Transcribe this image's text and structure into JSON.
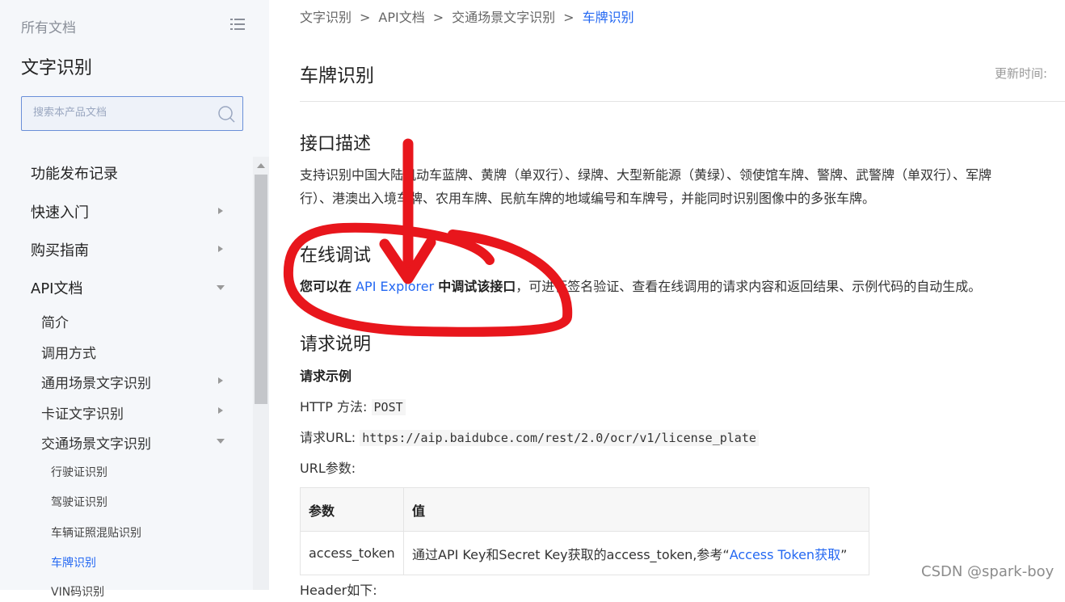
{
  "sidebar": {
    "all_docs": "所有文档",
    "product_title": "文字识别",
    "search_placeholder": "搜索本产品文档",
    "items": [
      {
        "label": "功能发布记录"
      },
      {
        "label": "快速入门"
      },
      {
        "label": "购买指南"
      },
      {
        "label": "API文档"
      }
    ],
    "api_children": [
      {
        "label": "简介"
      },
      {
        "label": "调用方式"
      },
      {
        "label": "通用场景文字识别"
      },
      {
        "label": "卡证文字识别"
      },
      {
        "label": "交通场景文字识别"
      }
    ],
    "traffic_children": [
      {
        "label": "行驶证识别"
      },
      {
        "label": "驾驶证识别"
      },
      {
        "label": "车辆证照混贴识别"
      },
      {
        "label": "车牌识别",
        "active": true
      },
      {
        "label": "VIN码识别"
      }
    ]
  },
  "breadcrumb": [
    "文字识别",
    "API文档",
    "交通场景文字识别",
    "车牌识别"
  ],
  "breadcrumb_sep": ">",
  "page": {
    "title": "车牌识别",
    "updated_label": "更新时间:",
    "section_interface": "接口描述",
    "interface_desc_line1": "支持识别中国大陆机动车蓝牌、黄牌（单双行）、绿牌、大型新能源（黄绿）、领使馆车牌、警牌、武警牌（单双行）、军牌",
    "interface_desc_line2": "行）、港澳出入境车牌、农用车牌、民航车牌的地域编号和车牌号，并能同时识别图像中的多张车牌。",
    "section_online": "在线调试",
    "online_prefix": "您可以在",
    "online_link": "API Explorer",
    "online_mid": "中调试该接口",
    "online_rest": "，可进行签名验证、查看在线调用的请求内容和返回结果、示例代码的自动生成。",
    "section_request": "请求说明",
    "request_example": "请求示例",
    "http_method_label": "HTTP 方法:",
    "http_method": "POST",
    "request_url_label": "请求URL:",
    "request_url": "https://aip.baidubce.com/rest/2.0/ocr/v1/license_plate",
    "url_params_label": "URL参数:",
    "table": {
      "headers": [
        "参数",
        "值"
      ],
      "rows": [
        {
          "param": "access_token",
          "value_prefix": "通过API Key和Secret Key获取的access_token,参考“",
          "value_link": "Access Token获取",
          "value_suffix": "”"
        }
      ]
    },
    "header_label": "Header如下:"
  },
  "watermark": "CSDN @spark-boy",
  "colors": {
    "accent": "#2468f2",
    "annotation": "#e8161c"
  }
}
